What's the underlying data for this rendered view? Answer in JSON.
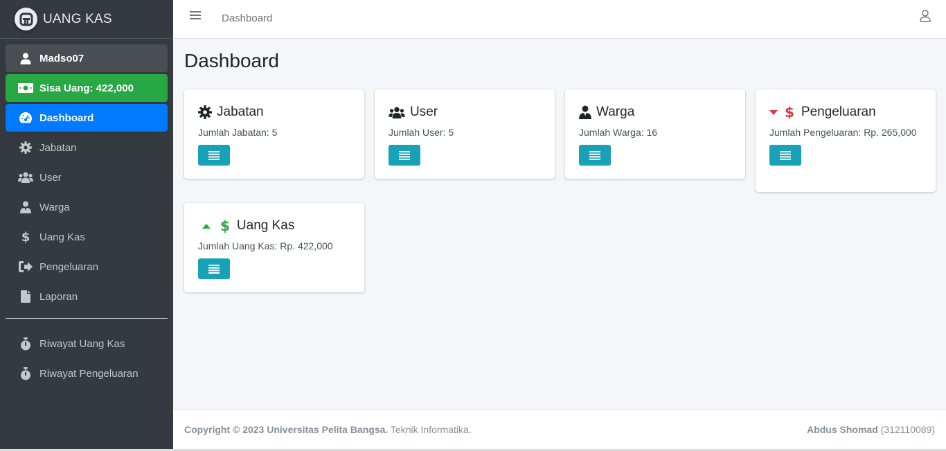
{
  "brand": {
    "name": "UANG KAS",
    "logo_icon": "app-logo-icon"
  },
  "sidebar": {
    "user": {
      "label": "Madso07",
      "icon": "user-icon"
    },
    "balance": {
      "label": "Sisa Uang: 422,000",
      "icon": "money-bill-icon"
    },
    "items": [
      {
        "label": "Dashboard",
        "icon": "tachometer-icon",
        "active": true
      },
      {
        "label": "Jabatan",
        "icon": "gear-icon"
      },
      {
        "label": "User",
        "icon": "users-icon"
      },
      {
        "label": "Warga",
        "icon": "user-tie-icon"
      },
      {
        "label": "Uang Kas",
        "icon": "dollar-icon"
      },
      {
        "label": "Pengeluaran",
        "icon": "sign-out-icon"
      },
      {
        "label": "Laporan",
        "icon": "file-icon"
      }
    ],
    "history": [
      {
        "label": "Riwayat Uang Kas",
        "icon": "stopwatch-icon"
      },
      {
        "label": "Riwayat Pengeluaran",
        "icon": "stopwatch-icon"
      }
    ]
  },
  "header": {
    "breadcrumb": "Dashboard",
    "user_icon": "user-outline-icon"
  },
  "main": {
    "title": "Dashboard",
    "cards": [
      {
        "title": "Jabatan",
        "text": "Jumlah Jabatan: 5",
        "icon": "gear-icon"
      },
      {
        "title": "User",
        "text": "Jumlah User: 5",
        "icon": "users-icon"
      },
      {
        "title": "Warga",
        "text": "Jumlah Warga: 16",
        "icon": "user-tie-icon"
      },
      {
        "title": "Pengeluaran",
        "text": "Jumlah Pengeluaran: Rp. 265,000",
        "icon": "caret-down-dollar-icon"
      },
      {
        "title": "Uang Kas",
        "text": "Jumlah Uang Kas: Rp. 422,000",
        "icon": "caret-up-dollar-icon"
      }
    ]
  },
  "footer": {
    "copyright_bold": "Copyright © 2023 Universitas Pelita Bangsa.",
    "copyright_rest": " Teknik Informatika.",
    "author_bold": "Abdus Shomad",
    "author_id": " (312110089)"
  },
  "colors": {
    "sidebar": "#343a40",
    "active": "#007bff",
    "balance": "#28a745",
    "button": "#17a2b8",
    "down": "#dc3545",
    "up": "#28a745"
  }
}
